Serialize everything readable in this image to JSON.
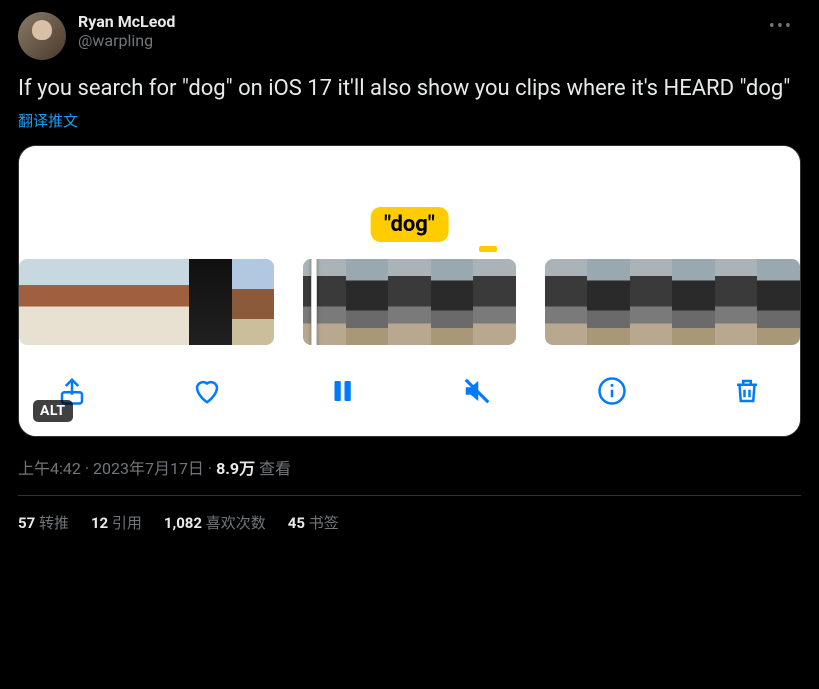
{
  "author": {
    "display_name": "Ryan McLeod",
    "handle": "@warpling"
  },
  "tweet_text": "If you search for \"dog\" on iOS 17 it'll also show you clips where it's HEARD \"dog\"",
  "translate_label": "翻译推文",
  "media": {
    "caption_chip": "\"dog\"",
    "alt_badge": "ALT",
    "toolbar_icons": {
      "share": "share-icon",
      "like": "heart-icon",
      "pause": "pause-icon",
      "mute": "mute-icon",
      "info": "info-icon",
      "delete": "trash-icon"
    }
  },
  "meta": {
    "time": "上午4:42",
    "separator": " · ",
    "date": "2023年7月17日",
    "views_count": "8.9万",
    "views_label": " 查看"
  },
  "stats": {
    "retweets_count": "57",
    "retweets_label": " 转推",
    "quotes_count": "12",
    "quotes_label": " 引用",
    "likes_count": "1,082",
    "likes_label": " 喜欢次数",
    "bookmarks_count": "45",
    "bookmarks_label": " 书签"
  }
}
